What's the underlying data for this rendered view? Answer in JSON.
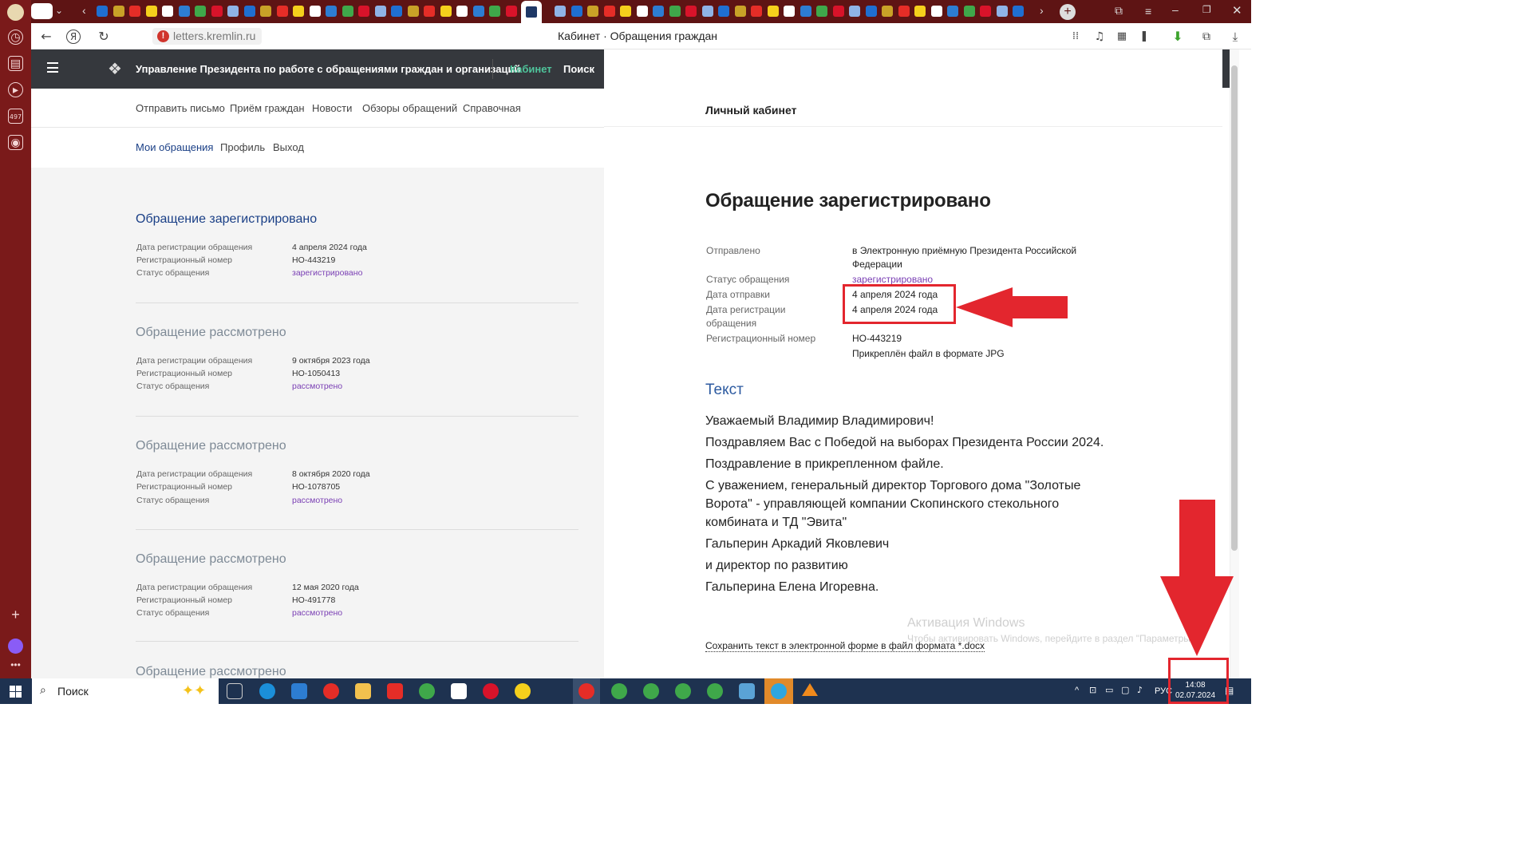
{
  "browser": {
    "url": "letters.kremlin.ru",
    "page_title": "Кабинет · Обращения граждан",
    "rail_badge": "497"
  },
  "site": {
    "name": "Управление Президента по работе с обращениями граждан и организаций",
    "nav_cabinet": "Кабинет",
    "nav_search": "Поиск",
    "subnav": [
      "Отправить письмо",
      "Приём граждан",
      "Новости",
      "Обзоры обращений",
      "Справочная"
    ],
    "subnav2": [
      "Мои обращения",
      "Профиль",
      "Выход"
    ]
  },
  "list": {
    "labels": {
      "reg_date": "Дата регистрации обращения",
      "reg_num": "Регистрационный номер",
      "status": "Статус обращения"
    },
    "items": [
      {
        "title": "Обращение зарегистрировано",
        "date": "4 апреля 2024 года",
        "number": "НО-443219",
        "status": "зарегистрировано"
      },
      {
        "title": "Обращение рассмотрено",
        "date": "9 октября 2023 года",
        "number": "НО-1050413",
        "status": "рассмотрено"
      },
      {
        "title": "Обращение рассмотрено",
        "date": "8 октября 2020 года",
        "number": "НО-1078705",
        "status": "рассмотрено"
      },
      {
        "title": "Обращение рассмотрено",
        "date": "12 мая 2020 года",
        "number": "НО-491778",
        "status": "рассмотрено"
      },
      {
        "title": "Обращение рассмотрено"
      }
    ]
  },
  "detail": {
    "cabinet_title": "Личный кабинет",
    "title": "Обращение зарегистрировано",
    "sent_label": "Отправлено",
    "sent_value": "в Электронную приёмную Президента Российской Федерации",
    "status_label": "Статус обращения",
    "status_value": "зарегистрировано",
    "send_date_label": "Дата отправки",
    "send_date_value": "4 апреля 2024 года",
    "reg_date_label": "Дата регистрации обращения",
    "reg_date_value": "4 апреля 2024 года",
    "reg_num_label": "Регистрационный номер",
    "reg_num_value": "НО-443219",
    "attachment": "Прикреплён файл в формате JPG",
    "text_heading": "Текст",
    "text_lines": [
      "Уважаемый Владимир Владимирович!",
      "Поздравляем Вас с Победой на выборах Президента России 2024.",
      "Поздравление в прикрепленном файле.",
      "С уважением, генеральный директор Торгового дома \"Золотые Ворота\" - управляющей компании Скопинского стекольного комбината и ТД \"Эвита\"",
      "Гальперин Аркадий Яковлевич",
      "и директор по развитию",
      "Гальперина Елена Игоревна."
    ],
    "save_link": "Сохранить текст в электронной форме в файл формата *.docx"
  },
  "watermark": {
    "title": "Активация Windows",
    "subtitle": "Чтобы активировать Windows, перейдите в раздел \"Параметры\"."
  },
  "taskbar": {
    "search_label": "Поиск",
    "lang": "РУС",
    "time": "14:08",
    "date": "02.07.2024"
  },
  "colors": {
    "browser_chrome": "#5e1414",
    "site_header": "#35383d",
    "accent_green": "#4fc49b",
    "link_blue": "#1a3f86",
    "status_purple": "#7a3fb4",
    "annotation_red": "#e3262e",
    "taskbar": "#1e3250"
  }
}
